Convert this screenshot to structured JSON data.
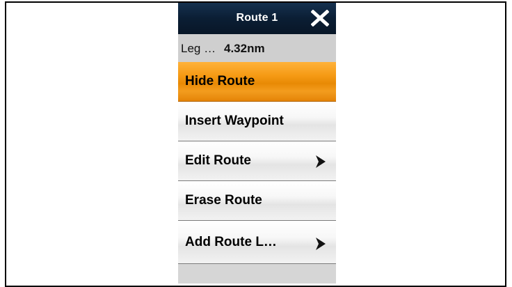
{
  "dialog": {
    "title": "Route 1",
    "close_icon": "close-x-icon"
  },
  "info": {
    "label": "Leg …",
    "value": "4.32nm"
  },
  "menu": {
    "items": [
      {
        "label": "Hide Route",
        "selected": true,
        "has_submenu": false
      },
      {
        "label": "Insert Waypoint",
        "selected": false,
        "has_submenu": false
      },
      {
        "label": "Edit Route",
        "selected": false,
        "has_submenu": true
      },
      {
        "label": "Erase Route",
        "selected": false,
        "has_submenu": false
      },
      {
        "label": "Add Route L…",
        "selected": false,
        "has_submenu": true
      }
    ]
  },
  "colors": {
    "title_bar": "#0b1e34",
    "selected": "#f59a14",
    "item_bg": "#f2f2f2"
  }
}
